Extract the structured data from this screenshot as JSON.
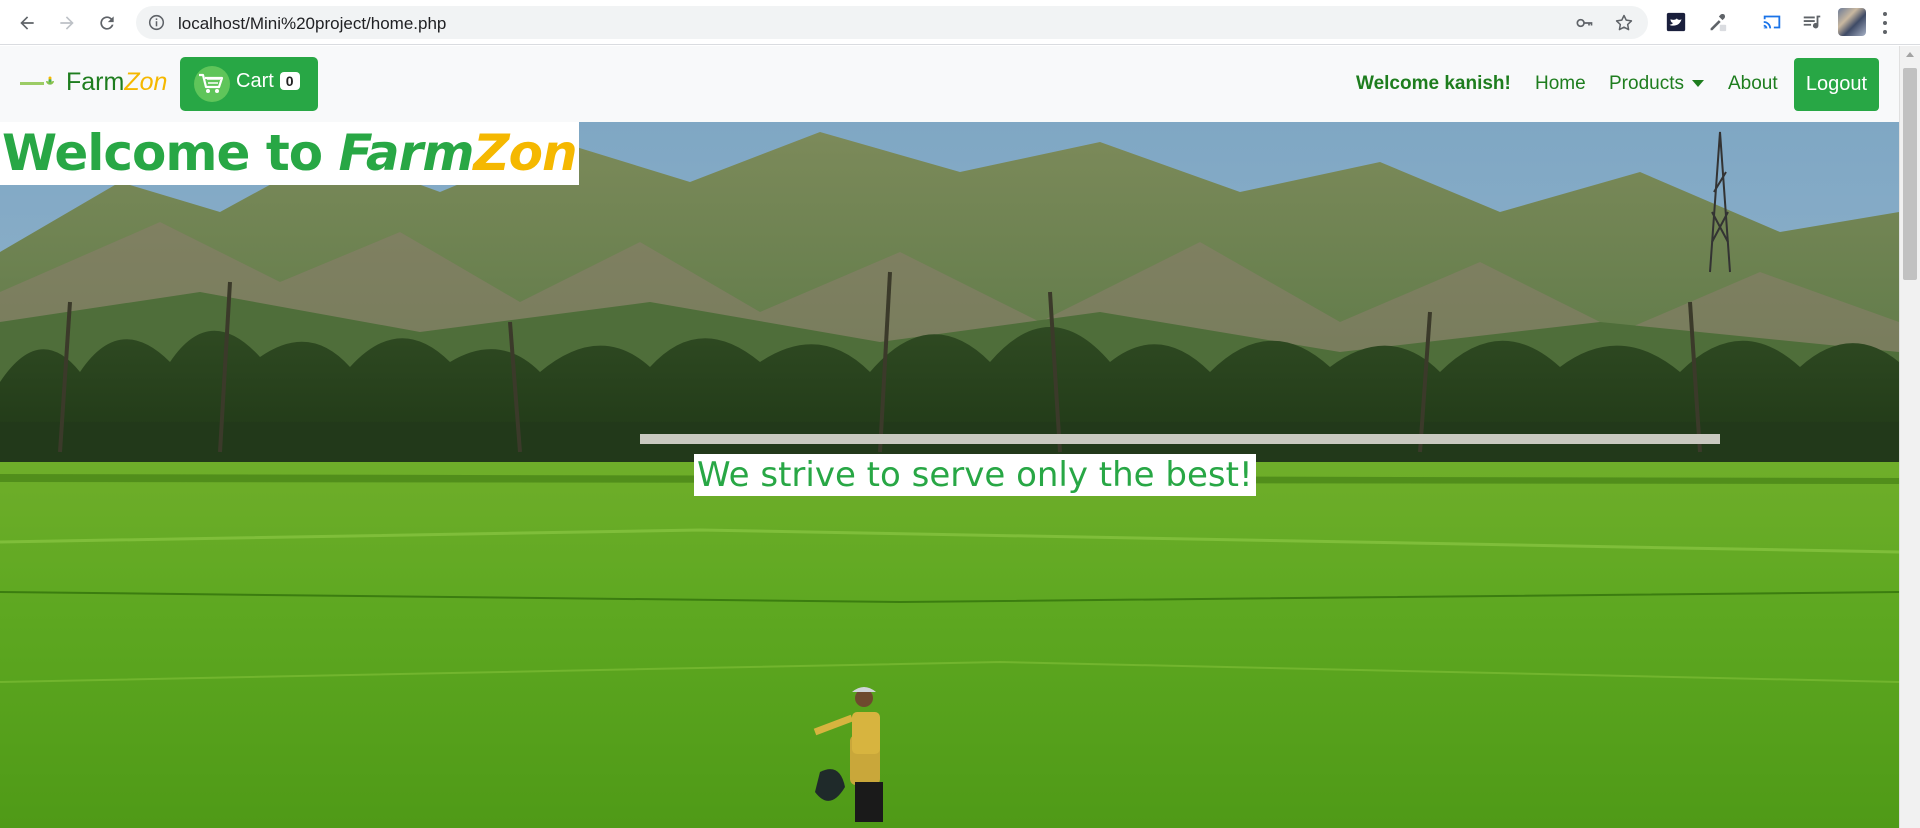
{
  "browser": {
    "url": "localhost/Mini%20project/home.php"
  },
  "navbar": {
    "brand_prefix": "Farm",
    "brand_suffix": "Zon",
    "cart_label": "Cart",
    "cart_count": "0",
    "welcome_text": "Welcome kanish!",
    "links": {
      "home": "Home",
      "products": "Products",
      "about": "About"
    },
    "logout_label": "Logout"
  },
  "hero": {
    "title_prefix": "Welcome to ",
    "title_brand_prefix": "Farm",
    "title_brand_suffix": "Zon",
    "tagline": "We strive to serve only the best!"
  },
  "colors": {
    "brand_green": "#28a745",
    "brand_yellow": "#f5b800",
    "nav_text": "#1e7d1e"
  }
}
